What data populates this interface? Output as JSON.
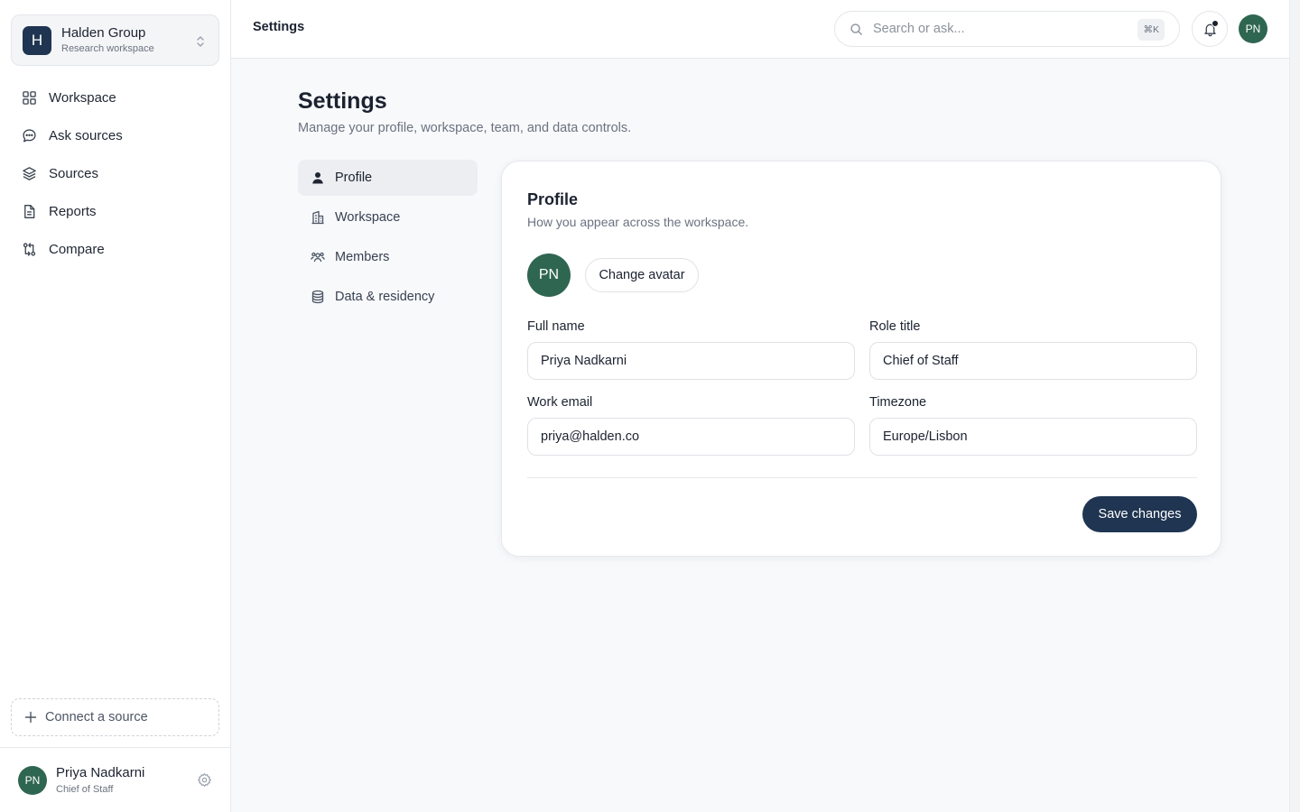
{
  "workspace": {
    "logo_letter": "H",
    "name": "Halden Group",
    "subtitle": "Research workspace"
  },
  "sidebar": {
    "items": [
      {
        "label": "Workspace",
        "icon": "grid-icon"
      },
      {
        "label": "Ask sources",
        "icon": "chat-bubble-icon"
      },
      {
        "label": "Sources",
        "icon": "layers-icon"
      },
      {
        "label": "Reports",
        "icon": "document-icon"
      },
      {
        "label": "Compare",
        "icon": "git-compare-icon"
      }
    ],
    "connect_label": "Connect a source"
  },
  "user": {
    "initials": "PN",
    "name": "Priya Nadkarni",
    "role": "Chief of Staff"
  },
  "topbar": {
    "breadcrumb": "Settings",
    "search_placeholder": "Search or ask...",
    "search_shortcut": "⌘K",
    "avatar_initials": "PN"
  },
  "page": {
    "title": "Settings",
    "subtitle": "Manage your profile, workspace, team, and data controls."
  },
  "settings_nav": {
    "active": "Profile",
    "items": [
      {
        "label": "Profile",
        "icon": "person-icon"
      },
      {
        "label": "Workspace",
        "icon": "building-icon"
      },
      {
        "label": "Members",
        "icon": "people-icon"
      },
      {
        "label": "Data & residency",
        "icon": "database-icon"
      }
    ]
  },
  "profile": {
    "title": "Profile",
    "subtitle": "How you appear across the workspace.",
    "avatar_initials": "PN",
    "change_avatar_label": "Change avatar",
    "full_name_label": "Full name",
    "full_name": "Priya Nadkarni",
    "role_title_label": "Role title",
    "role_title": "Chief of Staff",
    "work_email_label": "Work email",
    "work_email": "priya@halden.co",
    "timezone_label": "Timezone",
    "timezone": "Europe/Lisbon",
    "save_label": "Save changes"
  },
  "colors": {
    "primary": "#1f3551",
    "avatar": "#2f6651",
    "background": "#f8f9fb"
  }
}
